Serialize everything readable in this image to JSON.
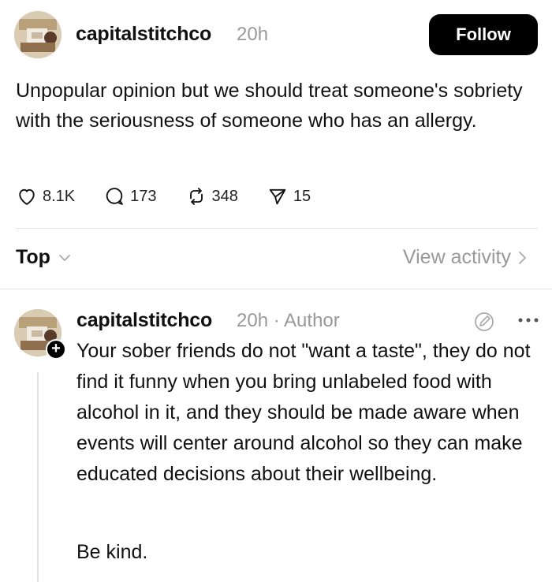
{
  "post": {
    "username": "capitalstitchco",
    "time": "20h",
    "follow_label": "Follow",
    "body": "Unpopular opinion but we should treat someone's sobriety with the seriousness of someone who has an allergy.",
    "stats": {
      "likes": "8.1K",
      "comments": "173",
      "reposts": "348",
      "shares": "15"
    }
  },
  "sort": {
    "label": "Top",
    "view_activity": "View activity"
  },
  "reply": {
    "username": "capitalstitchco",
    "meta": "20h · Author",
    "body": "Your sober friends do not \"want a taste\", they do not find it funny when you bring unlabeled food with alcohol in it, and they should be made aware when events will center around alcohol so they can make educated decisions about their wellbeing.",
    "sign_off": "Be kind."
  },
  "colors": {
    "muted": "#999999",
    "text": "#111111",
    "button_bg": "#000000"
  }
}
